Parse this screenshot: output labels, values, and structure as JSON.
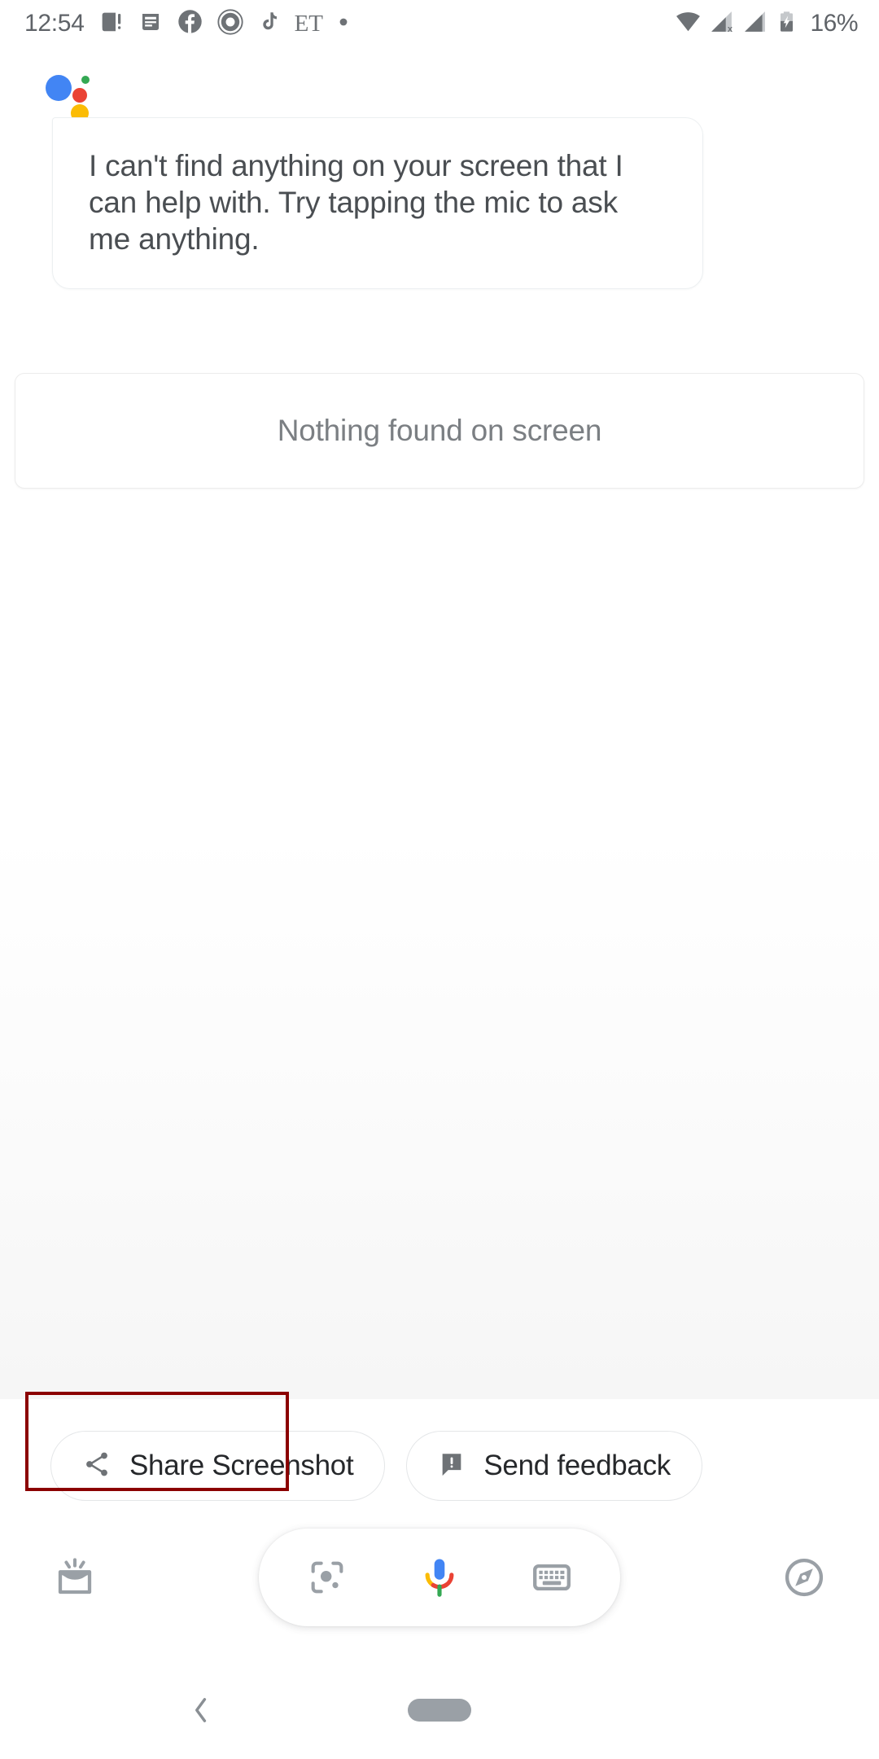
{
  "status_bar": {
    "clock": "12:54",
    "battery_percent": "16%",
    "left_icons": [
      "broken-image-icon",
      "news-article-icon",
      "facebook-icon",
      "instagram-ring-icon",
      "tiktok-icon",
      "et-text-icon",
      "dot-icon"
    ],
    "et_label": "ET",
    "right_icons": [
      "wifi-icon",
      "signal-no-service-icon",
      "signal-bars-icon",
      "battery-charging-icon"
    ]
  },
  "assistant": {
    "logo": "google-assistant-logo",
    "reply_text": "I can't find anything on your screen that I can help with. Try tapping the mic to ask me anything.",
    "screen_card_text": "Nothing found on screen"
  },
  "chips": [
    {
      "id": "share-screenshot",
      "label": "Share Screenshot",
      "icon": "share-icon",
      "highlighted": true
    },
    {
      "id": "send-feedback",
      "label": "Send feedback",
      "icon": "feedback-icon",
      "highlighted": false
    }
  ],
  "bottom_bar": {
    "left_icon": "snapshot-inbox-icon",
    "right_icon": "explore-compass-icon",
    "pill_items": [
      {
        "id": "lens",
        "icon": "google-lens-icon"
      },
      {
        "id": "mic",
        "icon": "google-mic-icon"
      },
      {
        "id": "keyboard",
        "icon": "keyboard-icon"
      }
    ]
  },
  "nav_bar": {
    "back": "back-chevron-icon",
    "home": "home-pill-handle"
  },
  "colors": {
    "google_blue": "#4285F4",
    "google_red": "#EA4335",
    "google_yellow": "#FBBC05",
    "google_green": "#34A853",
    "icon_gray": "#9aa0a6",
    "text_gray": "#5f6368",
    "highlight_box": "#8b0000"
  }
}
